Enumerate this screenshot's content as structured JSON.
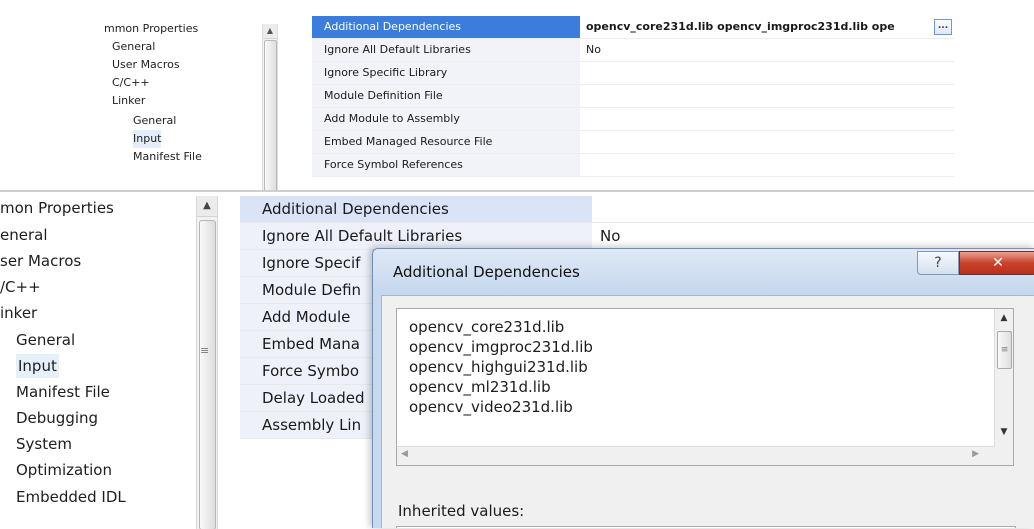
{
  "top_panel": {
    "tree": [
      {
        "label": "mmon Properties",
        "level": 0
      },
      {
        "label": "General",
        "level": 1
      },
      {
        "label": "User Macros",
        "level": 1
      },
      {
        "label": "C/C++",
        "level": 1
      },
      {
        "label": "Linker",
        "level": 1
      },
      {
        "label": "General",
        "level": 2
      },
      {
        "label": "Input",
        "level": 2
      },
      {
        "label": "Manifest File",
        "level": 2
      }
    ],
    "properties": [
      {
        "name": "Additional Dependencies",
        "value": "opencv_core231d.lib opencv_imgproc231d.lib ope"
      },
      {
        "name": "Ignore All Default Libraries",
        "value": "No"
      },
      {
        "name": "Ignore Specific Library",
        "value": ""
      },
      {
        "name": "Module Definition File",
        "value": ""
      },
      {
        "name": "Add Module to Assembly",
        "value": ""
      },
      {
        "name": "Embed Managed Resource File",
        "value": ""
      },
      {
        "name": "Force Symbol References",
        "value": ""
      }
    ],
    "ellipsis_label": "..."
  },
  "bottom_panel": {
    "tree": [
      {
        "label": "mon Properties"
      },
      {
        "label": "eneral"
      },
      {
        "label": "ser Macros"
      },
      {
        "label": "/C++"
      },
      {
        "label": "inker"
      },
      {
        "label": "General"
      },
      {
        "label": "Input"
      },
      {
        "label": "Manifest File"
      },
      {
        "label": "Debugging"
      },
      {
        "label": "System"
      },
      {
        "label": "Optimization"
      },
      {
        "label": "Embedded IDL"
      }
    ],
    "properties": [
      {
        "name": "Additional Dependencies",
        "value": ""
      },
      {
        "name": "Ignore All Default Libraries",
        "value": "No"
      },
      {
        "name": "Ignore Specif",
        "value": ""
      },
      {
        "name": "Module Defin",
        "value": ""
      },
      {
        "name": "Add Module",
        "value": ""
      },
      {
        "name": "Embed Mana",
        "value": ""
      },
      {
        "name": "Force Symbo",
        "value": ""
      },
      {
        "name": "Delay Loaded",
        "value": ""
      },
      {
        "name": "Assembly Lin",
        "value": ""
      }
    ]
  },
  "dialog": {
    "title": "Additional Dependencies",
    "help_label": "?",
    "close_label": "✕",
    "libraries": [
      "opencv_core231d.lib",
      "opencv_imgproc231d.lib",
      "opencv_highgui231d.lib",
      "opencv_ml231d.lib",
      "opencv_video231d.lib"
    ],
    "inherited_label": "Inherited values:"
  },
  "colors": {
    "selection_blue": "#3a7ddd",
    "close_red": "#c7432c",
    "dialog_frame": "#c7d9ef"
  }
}
